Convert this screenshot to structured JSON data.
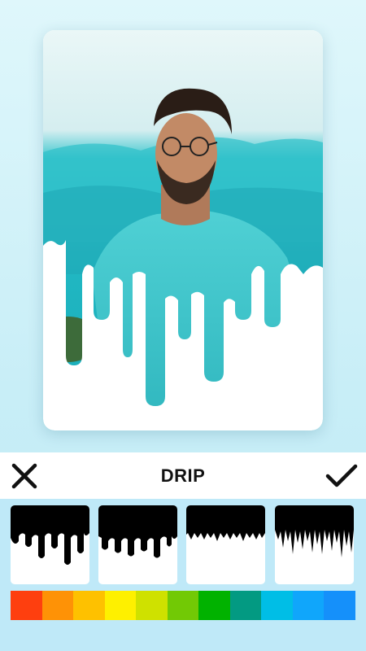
{
  "toolbar": {
    "title": "DRIP",
    "close_icon": "close-icon",
    "confirm_icon": "checkmark-icon"
  },
  "photo": {
    "description_icon": "photo-preview",
    "drip_color": "#ffffff"
  },
  "drip_styles": [
    {
      "name": "drip-style-1"
    },
    {
      "name": "drip-style-2"
    },
    {
      "name": "drip-style-3"
    },
    {
      "name": "drip-style-4"
    }
  ],
  "palette": [
    "#fe3f0f",
    "#fe9206",
    "#fec100",
    "#fef000",
    "#cfe100",
    "#72c905",
    "#01b200",
    "#039a82",
    "#00bee6",
    "#10a6fb",
    "#1590fa"
  ]
}
